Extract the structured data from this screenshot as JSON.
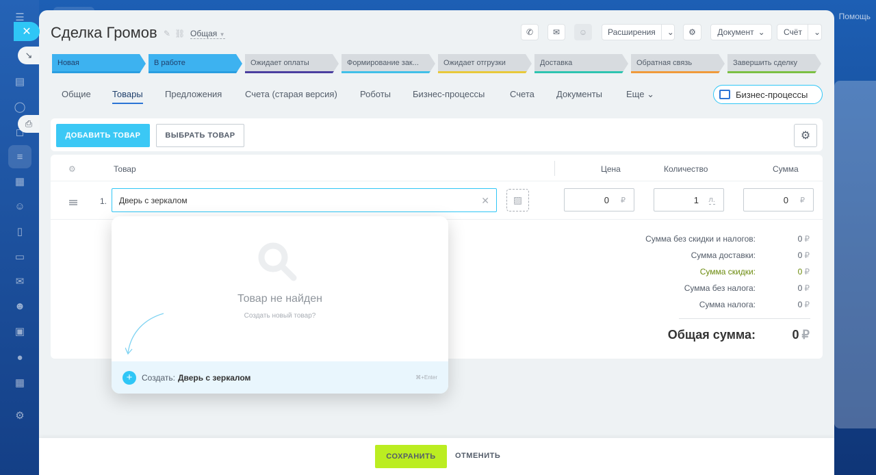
{
  "help": "Помощь",
  "header": {
    "title": "Сделка Громов",
    "category": "Общая",
    "buttons": {
      "extensions": "Расширения",
      "document": "Документ",
      "invoice": "Счёт"
    }
  },
  "stages": [
    {
      "label": "Новая",
      "color": "#3db2f0"
    },
    {
      "label": "В работе",
      "color": "#3db2f0"
    },
    {
      "label": "Ожидает оплаты",
      "color": "#4b3fa0"
    },
    {
      "label": "Формирование зак...",
      "color": "#40c0e8"
    },
    {
      "label": "Ожидает отгрузки",
      "color": "#e8c93a"
    },
    {
      "label": "Доставка",
      "color": "#2ec4b0"
    },
    {
      "label": "Обратная связь",
      "color": "#f09a3a"
    },
    {
      "label": "Завершить сделку",
      "color": "#7bc043"
    }
  ],
  "tabs": [
    "Общие",
    "Товары",
    "Предложения",
    "Счета (старая версия)",
    "Роботы",
    "Бизнес-процессы",
    "Счета",
    "Документы",
    "Еще"
  ],
  "bp_button": "Бизнес-процессы",
  "toolbar": {
    "add": "ДОБАВИТЬ ТОВАР",
    "select": "ВЫБРАТЬ ТОВАР"
  },
  "table": {
    "headers": {
      "product": "Товар",
      "price": "Цена",
      "quantity": "Количество",
      "sum": "Сумма"
    },
    "row": {
      "num": "1.",
      "product": "Дверь с зеркалом",
      "price": "0",
      "price_currency": "₽",
      "qty": "1",
      "qty_unit": "л.",
      "sum": "0",
      "sum_currency": "₽"
    }
  },
  "summary": [
    {
      "label": "Сумма без скидки и налогов:",
      "value": "0",
      "currency": "₽"
    },
    {
      "label": "Сумма доставки:",
      "value": "0",
      "currency": "₽"
    },
    {
      "label": "Сумма скидки:",
      "value": "0",
      "currency": "₽"
    },
    {
      "label": "Сумма без налога:",
      "value": "0",
      "currency": "₽"
    },
    {
      "label": "Сумма налога:",
      "value": "0",
      "currency": "₽"
    }
  ],
  "total": {
    "label": "Общая сумма:",
    "value": "0",
    "currency": "₽"
  },
  "dropdown": {
    "not_found": "Товар не найден",
    "create_new": "Создать новый товар?",
    "create_prefix": "Создать:",
    "create_value": "Дверь с зеркалом",
    "hint": "⌘+Enter"
  },
  "footer": {
    "save": "СОХРАНИТЬ",
    "cancel": "ОТМЕНИТЬ"
  }
}
